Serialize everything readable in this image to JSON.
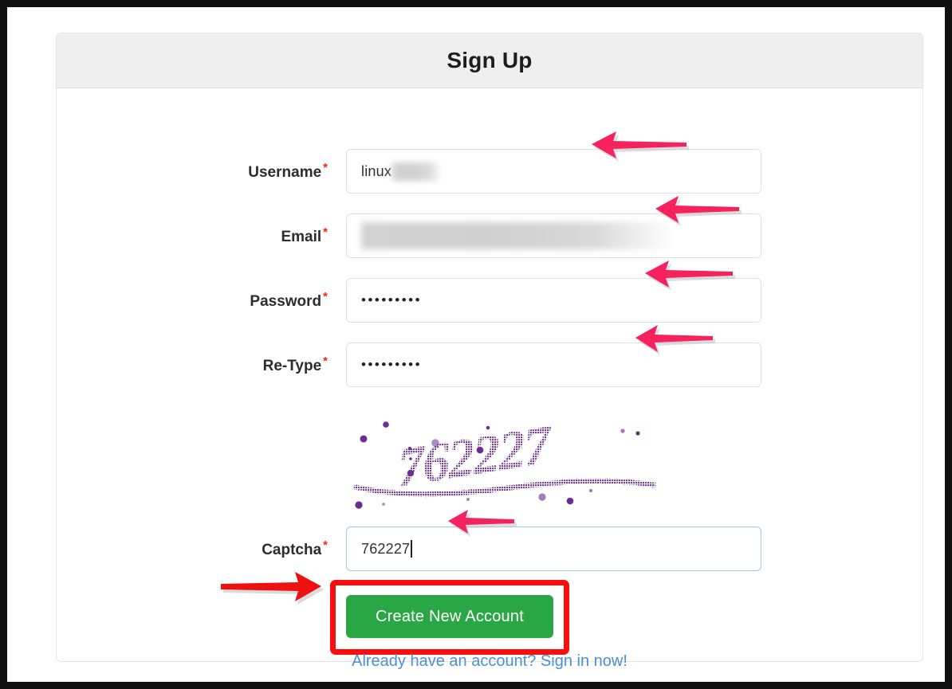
{
  "card": {
    "title": "Sign Up"
  },
  "form": {
    "fields": [
      {
        "key": "username",
        "label": "Username",
        "required_marker": "*",
        "value": "linux",
        "redacted_suffix": true,
        "type": "text"
      },
      {
        "key": "email",
        "label": "Email",
        "required_marker": "*",
        "value": "",
        "redacted_suffix": true,
        "type": "email"
      },
      {
        "key": "password",
        "label": "Password",
        "required_marker": "*",
        "value": "•••••••••",
        "type": "password"
      },
      {
        "key": "retype",
        "label": "Re-Type",
        "required_marker": "*",
        "value": "•••••••••",
        "type": "password"
      },
      {
        "key": "captcha",
        "label": "Captcha",
        "required_marker": "*",
        "value": "762227",
        "type": "text",
        "focused": true
      }
    ]
  },
  "captcha": {
    "text": "762227",
    "color": "#6b2d8f",
    "alt_name": "captcha-image"
  },
  "actions": {
    "submit_label": "Create New Account",
    "signin_link_label": "Already have an account? Sign in now!"
  },
  "colors": {
    "submit_green": "#2aa745",
    "highlight_red": "#fb0d0d",
    "arrow_pink": "#f5225e",
    "arrow_red": "#ee1111",
    "link_blue": "#4b8fd4",
    "required_red": "#e8291c",
    "header_gray": "#efefef"
  },
  "annotations": {
    "arrows": [
      {
        "name": "arrow-username",
        "direction": "left",
        "color": "#f5225e"
      },
      {
        "name": "arrow-email",
        "direction": "left",
        "color": "#f5225e"
      },
      {
        "name": "arrow-password",
        "direction": "left",
        "color": "#f5225e"
      },
      {
        "name": "arrow-retype",
        "direction": "left",
        "color": "#f5225e"
      },
      {
        "name": "arrow-captcha",
        "direction": "left",
        "color": "#f5225e"
      },
      {
        "name": "arrow-submit",
        "direction": "right",
        "color": "#ee1111"
      }
    ],
    "highlight_box": {
      "name": "submit-highlight-box",
      "color": "#fb0d0d"
    }
  }
}
